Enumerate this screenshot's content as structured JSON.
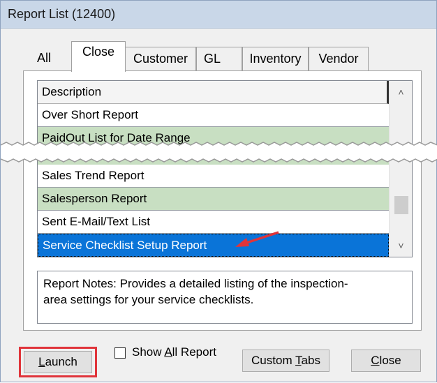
{
  "window": {
    "title": "Report List (12400)"
  },
  "tabs": [
    {
      "label": "All"
    },
    {
      "label": "Close",
      "active": true
    },
    {
      "label": "Customer"
    },
    {
      "label": "GL"
    },
    {
      "label": "Inventory"
    },
    {
      "label": "Vendor"
    }
  ],
  "list": {
    "header": "Description",
    "rows_top": [
      {
        "label": "Over Short Report"
      },
      {
        "label": "PaidOut List for Date Range"
      }
    ],
    "rows_bottom": [
      {
        "label": "Sales Trend Report"
      },
      {
        "label": "Salesperson Report"
      },
      {
        "label": "Sent E-Mail/Text List"
      },
      {
        "label": "Service Checklist Setup Report"
      }
    ]
  },
  "notes": {
    "line1": "Report Notes:  Provides a detailed listing of the inspection-",
    "line2": "area settings for your service checklists."
  },
  "buttons": {
    "launch": {
      "underline": "L",
      "rest": "aunch"
    },
    "show_all": {
      "pre": "Show ",
      "underline": "A",
      "rest": "ll Report"
    },
    "custom_tabs": {
      "pre": "Custom ",
      "underline": "T",
      "rest": "abs"
    },
    "close": {
      "underline": "C",
      "rest": "lose"
    }
  },
  "colors": {
    "row_green": "#c8dfc2",
    "selected_row": "#0a74d8",
    "annotation_red": "#e0343a"
  }
}
